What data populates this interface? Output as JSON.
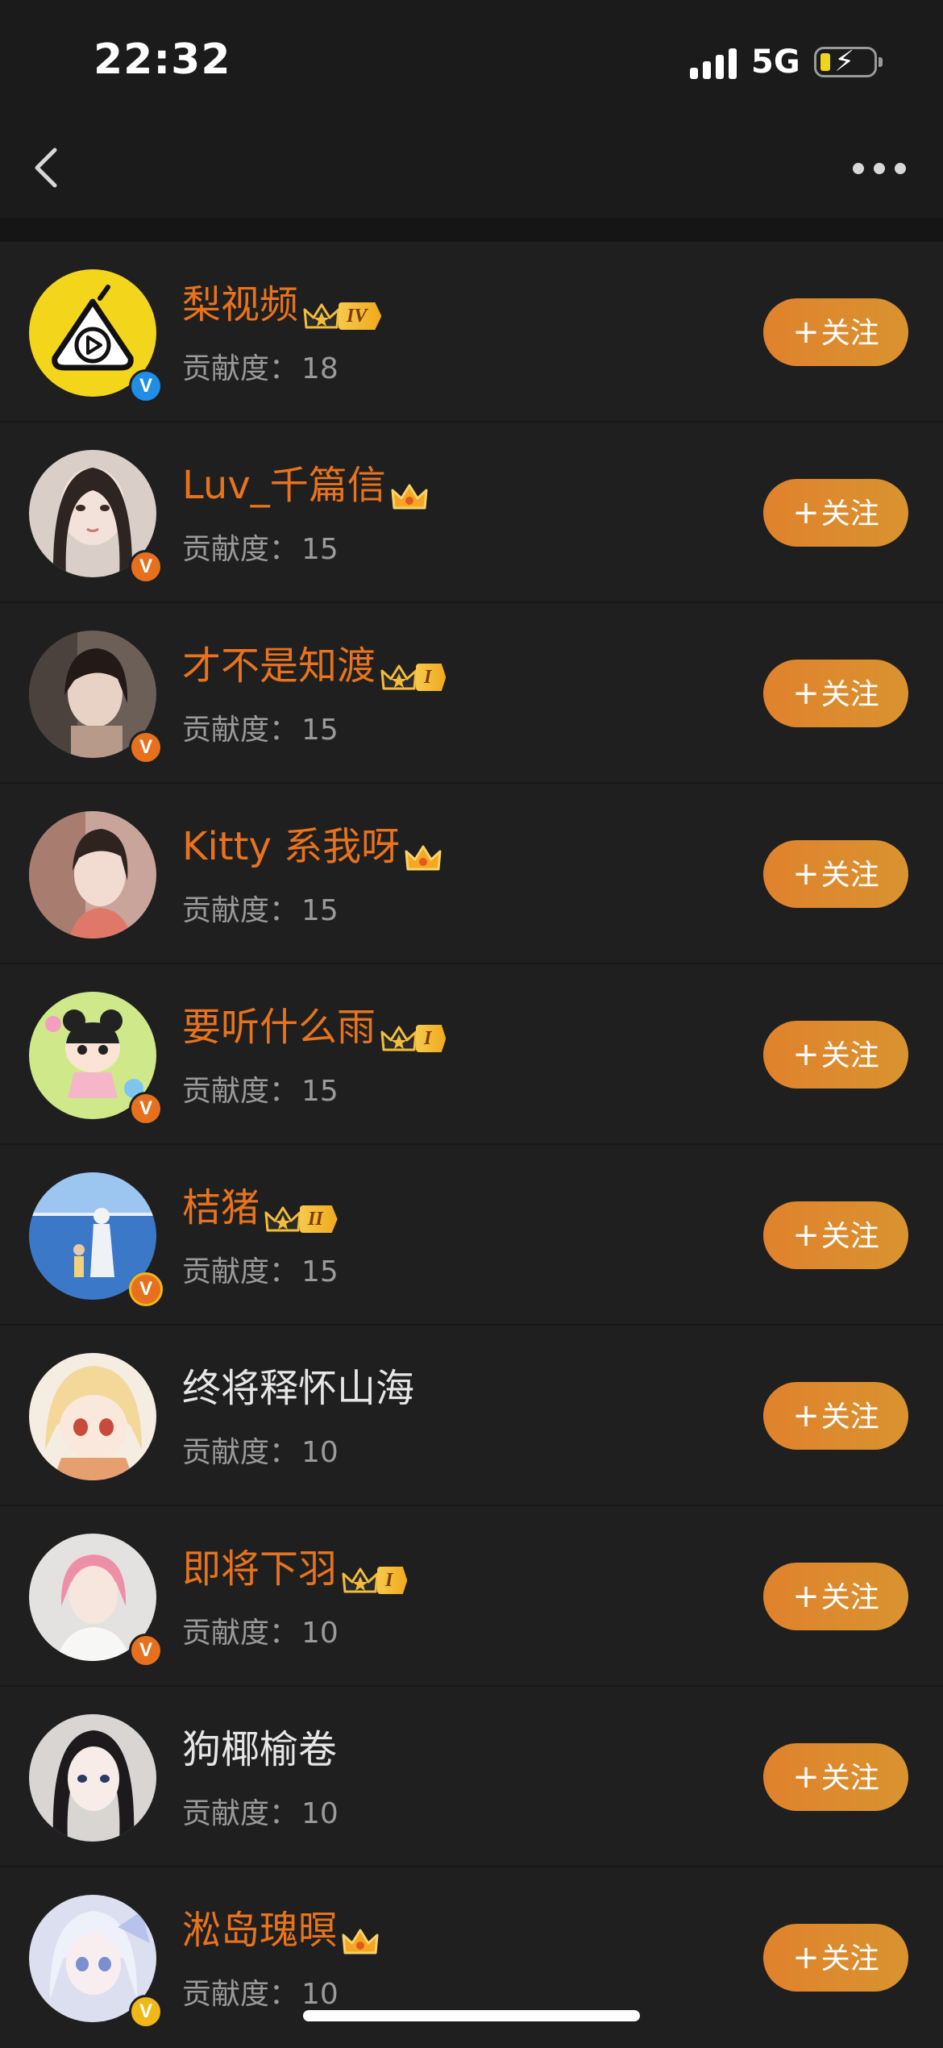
{
  "status_bar": {
    "time": "22:32",
    "network": "5G"
  },
  "colors": {
    "vip_name": "#e7731e",
    "follow_button": "#e0822d",
    "verified_blue": "#1f8ee6",
    "verified_orange": "#e6701e",
    "verified_gold": "#f0b817"
  },
  "follow_label": "关注",
  "score_label": "贡献度：",
  "users": [
    {
      "name": "梨视频",
      "score": "18",
      "vip": true,
      "rank": "IV",
      "badge": "blue"
    },
    {
      "name": "Luv_千篇信",
      "score": "15",
      "vip": true,
      "rank": "",
      "badge": "orange"
    },
    {
      "name": "才不是知渡",
      "score": "15",
      "vip": true,
      "rank": "I",
      "badge": "orange"
    },
    {
      "name": "Kitty 系我呀",
      "score": "15",
      "vip": true,
      "rank": "",
      "badge": "none"
    },
    {
      "name": "要听什么雨",
      "score": "15",
      "vip": true,
      "rank": "I",
      "badge": "orange"
    },
    {
      "name": "桔猪",
      "score": "15",
      "vip": true,
      "rank": "II",
      "badge": "orange-gold"
    },
    {
      "name": "终将释怀山海",
      "score": "10",
      "vip": false,
      "rank": "",
      "badge": "none"
    },
    {
      "name": "即将下羽",
      "score": "10",
      "vip": true,
      "rank": "I",
      "badge": "orange"
    },
    {
      "name": "狗椰榆卷",
      "score": "10",
      "vip": false,
      "rank": "",
      "badge": "none"
    },
    {
      "name": "淞岛瑰暝",
      "score": "10",
      "vip": true,
      "rank": "",
      "badge": "gold"
    }
  ]
}
